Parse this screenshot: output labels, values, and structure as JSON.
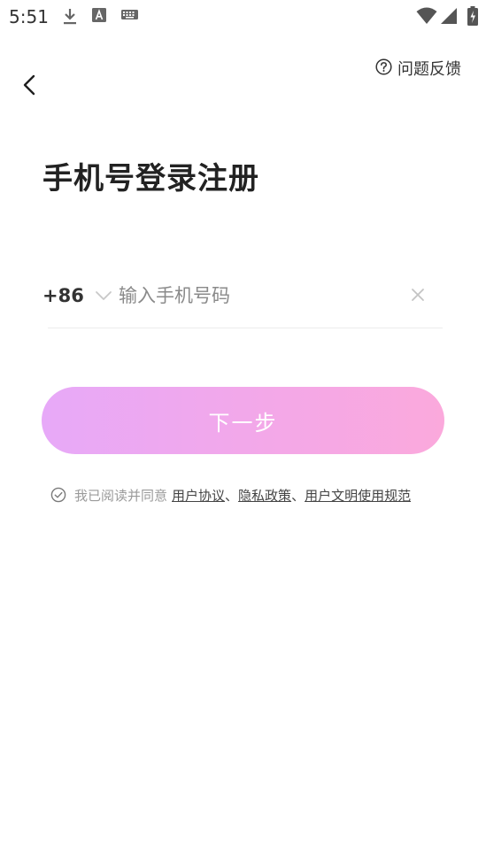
{
  "status_bar": {
    "time": "5:51",
    "icons": [
      "download-icon",
      "a-icon",
      "keyboard-icon",
      "wifi-icon",
      "signal-icon",
      "battery-icon"
    ]
  },
  "header": {
    "back_icon": "chevron-left-icon",
    "help_icon": "question-circle-icon",
    "help_label": "问题反馈"
  },
  "title": "手机号登录注册",
  "phone": {
    "country_code": "+86",
    "placeholder": "输入手机号码",
    "value": "",
    "clear_icon": "close-icon"
  },
  "next_button_label": "下一步",
  "agreement": {
    "prefix": "我已阅读并同意",
    "links": [
      "用户协议",
      "隐私政策",
      "用户文明使用规范"
    ],
    "separator": "、"
  },
  "colors": {
    "button_gradient_start": "#e7a9f8",
    "button_gradient_end": "#fba9dc",
    "title": "#222222",
    "placeholder": "#8a8a8a"
  }
}
